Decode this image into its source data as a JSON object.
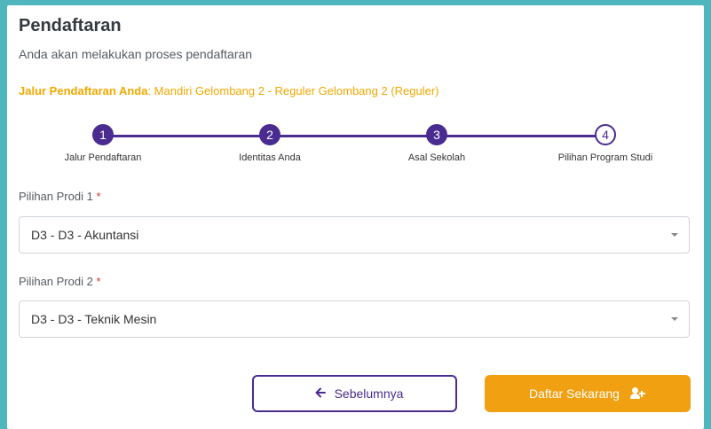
{
  "header": {
    "title": "Pendaftaran",
    "subtitle": "Anda akan melakukan proses pendaftaran"
  },
  "jalur": {
    "label": "Jalur Pendaftaran Anda",
    "value": ": Mandiri Gelombang 2 - Reguler Gelombang 2 (Reguler)"
  },
  "stepper": {
    "current_step": 4,
    "steps": [
      {
        "number": "1",
        "label": "Jalur Pendaftaran",
        "status": "done"
      },
      {
        "number": "2",
        "label": "Identitas Anda",
        "status": "done"
      },
      {
        "number": "3",
        "label": "Asal Sekolah",
        "status": "done"
      },
      {
        "number": "4",
        "label": "Pilihan Program Studi",
        "status": "active"
      }
    ]
  },
  "form": {
    "prodi1": {
      "label": "Pilihan Prodi 1",
      "required_mark": "*",
      "value": "D3 - D3 - Akuntansi"
    },
    "prodi2": {
      "label": "Pilihan Prodi 2",
      "required_mark": "*",
      "value": "D3 - D3 - Teknik Mesin"
    }
  },
  "actions": {
    "prev_label": "Sebelumnya",
    "next_label": "Daftar Sekarang"
  },
  "colors": {
    "primary": "#4a2c91",
    "accent": "#f0a011",
    "background": "#4fb6bd"
  }
}
